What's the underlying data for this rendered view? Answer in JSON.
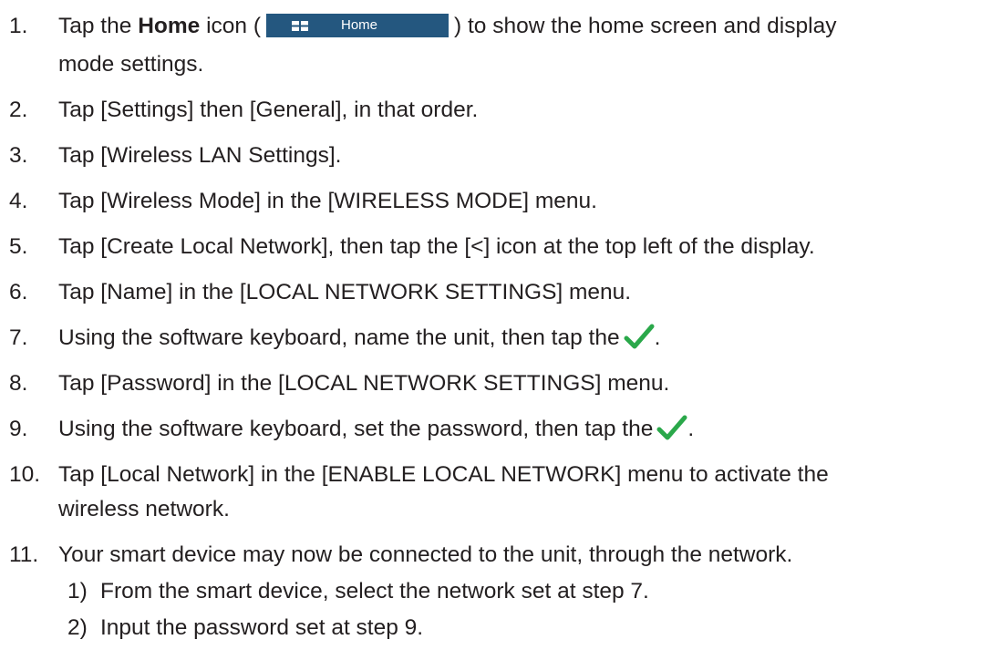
{
  "steps": [
    {
      "num": "1.",
      "a": "Tap the ",
      "bold": "Home",
      "b": " icon (",
      "c": ") to show the home screen and display",
      "line2": "mode settings."
    },
    {
      "num": "2.",
      "text": "Tap [Settings] then [General], in that order."
    },
    {
      "num": "3.",
      "text": "Tap [Wireless LAN Settings]."
    },
    {
      "num": "4.",
      "text": "Tap [Wireless Mode] in the [WIRELESS MODE] menu."
    },
    {
      "num": "5.",
      "text": "Tap [Create Local Network], then tap the [<] icon at the top left of the display."
    },
    {
      "num": "6.",
      "text": "Tap [Name] in the [LOCAL NETWORK SETTINGS] menu."
    },
    {
      "num": "7.",
      "text": "Using the software keyboard, name the unit, then tap the",
      "after": "."
    },
    {
      "num": "8.",
      "text": "Tap [Password] in the [LOCAL NETWORK SETTINGS] menu."
    },
    {
      "num": "9.",
      "text": "Using the software keyboard, set the password, then tap the",
      "after": "."
    },
    {
      "num": "10.",
      "text": "Tap [Local Network] in the [ENABLE LOCAL NETWORK] menu to activate the",
      "line2": "wireless network."
    },
    {
      "num": "11.",
      "text": "Your smart device may now be connected to the unit, through the network."
    }
  ],
  "substeps": [
    {
      "num": "1)",
      "text": "From the smart device, select the network set at step 7."
    },
    {
      "num": "2)",
      "text": "Input the password set at step 9."
    }
  ],
  "home_button": {
    "label": "Home",
    "color": "#24577f",
    "icon": "grid-icon"
  },
  "check_icon": {
    "color": "#2aa84a",
    "icon": "checkmark-icon"
  }
}
